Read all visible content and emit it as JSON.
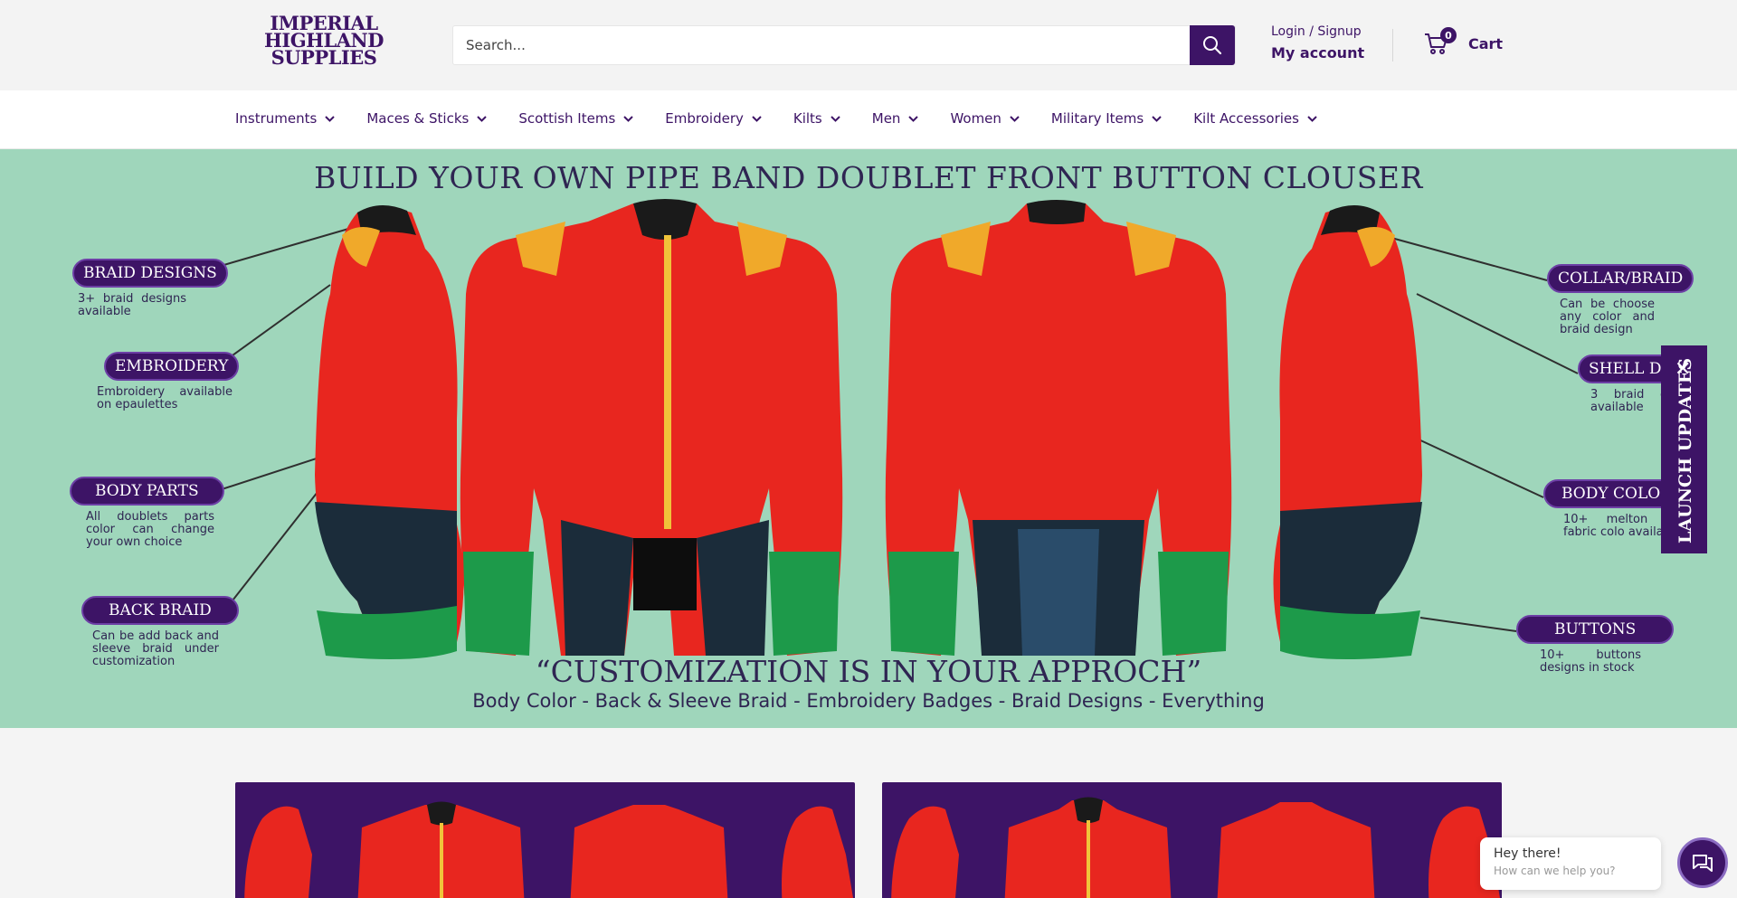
{
  "header": {
    "logo_lines": [
      "IMPERIAL",
      "HIGHLAND",
      "SUPPLIES"
    ],
    "search_placeholder": "Search...",
    "login_label": "Login / Signup",
    "account_label": "My account",
    "cart_count": "0",
    "cart_label": "Cart"
  },
  "nav": {
    "items": [
      {
        "label": "Instruments"
      },
      {
        "label": "Maces & Sticks"
      },
      {
        "label": "Scottish Items"
      },
      {
        "label": "Embroidery"
      },
      {
        "label": "Kilts"
      },
      {
        "label": "Men"
      },
      {
        "label": "Women"
      },
      {
        "label": "Military Items"
      },
      {
        "label": "Kilt Accessories"
      }
    ]
  },
  "hero": {
    "title": "BUILD YOUR OWN PIPE BAND DOUBLET FRONT BUTTON CLOUSER",
    "quote": "“CUSTOMIZATION IS IN YOUR APPROCH”",
    "subtitle": "Body Color - Back & Sleeve Braid - Embroidery Badges - Braid Designs - Everything",
    "callouts_left": [
      {
        "title": "BRAID DESIGNS",
        "desc": "3+ braid designs available"
      },
      {
        "title": "EMBROIDERY",
        "desc": "Embroidery available on epaulettes"
      },
      {
        "title": "BODY PARTS",
        "desc": "All doublets parts color can change your own choice"
      },
      {
        "title": "BACK BRAID",
        "desc": "Can be add back and sleeve braid under customization"
      }
    ],
    "callouts_right": [
      {
        "title": "COLLAR/BRAID",
        "desc": "Can be choose any color and braid design"
      },
      {
        "title": "SHELL DES",
        "desc": "3 braid des available"
      },
      {
        "title": "BODY COLOR",
        "desc": "10+ melton woo fabric colo available"
      },
      {
        "title": "BUTTONS",
        "desc": "10+ buttons designs in stock"
      }
    ]
  },
  "launch_updates": {
    "label": "LAUNCH UPDATES"
  },
  "chat": {
    "greeting": "Hey there!",
    "prompt": "How can we help you?"
  },
  "colors": {
    "brand": "#3d1466",
    "hero_bg": "#9fd6bb",
    "jacket_red": "#e8261f",
    "cuff_green": "#1d9a4a"
  }
}
